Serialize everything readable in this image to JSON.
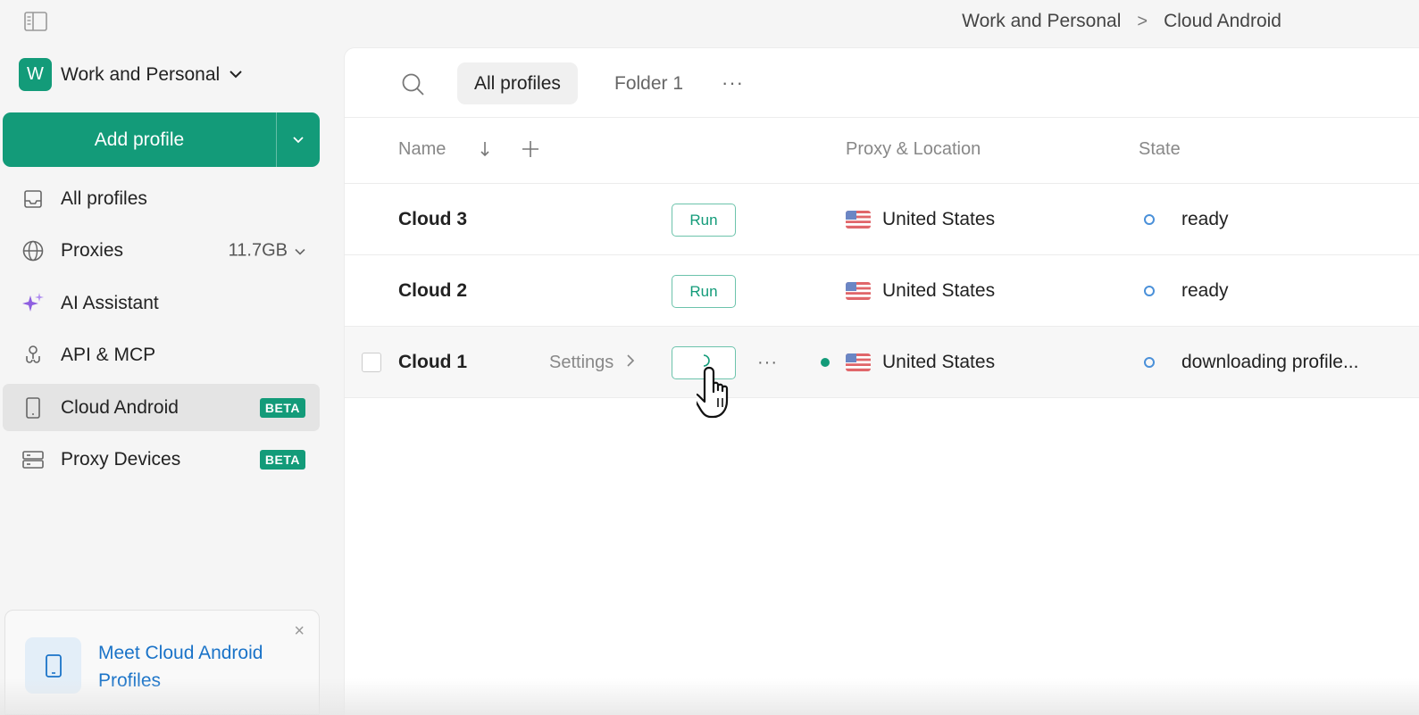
{
  "breadcrumb": {
    "items": [
      "Work and Personal",
      "Cloud Android"
    ],
    "separator": ">"
  },
  "workspace": {
    "initial": "W",
    "name": "Work and Personal"
  },
  "add_profile": {
    "label": "Add profile"
  },
  "sidebar": {
    "items": [
      {
        "label": "All profiles",
        "icon": "inbox-icon"
      },
      {
        "label": "Proxies",
        "icon": "globe-icon",
        "extra": "11.7GB"
      },
      {
        "label": "AI Assistant",
        "icon": "sparkle-icon"
      },
      {
        "label": "API & MCP",
        "icon": "api-icon"
      },
      {
        "label": "Cloud Android",
        "icon": "phone-icon",
        "badge": "BETA",
        "active": true
      },
      {
        "label": "Proxy Devices",
        "icon": "server-icon",
        "badge": "BETA"
      }
    ]
  },
  "promo": {
    "text": "Meet Cloud Android Profiles",
    "close": "×"
  },
  "tabs": [
    {
      "label": "All profiles",
      "active": true
    },
    {
      "label": "Folder 1"
    }
  ],
  "tabs_more": "···",
  "table": {
    "headers": {
      "name": "Name",
      "proxy": "Proxy & Location",
      "state": "State"
    },
    "rows": [
      {
        "name": "Cloud 3",
        "action": "Run",
        "location": "United States",
        "state": "ready"
      },
      {
        "name": "Cloud 2",
        "action": "Run",
        "location": "United States",
        "state": "ready"
      },
      {
        "name": "Cloud 1",
        "action": "",
        "settings": "Settings",
        "more": "···",
        "location": "United States",
        "state": "downloading profile..."
      }
    ]
  },
  "colors": {
    "accent": "#139b79",
    "link": "#1a73c8",
    "state_ring": "#4a90d9"
  }
}
